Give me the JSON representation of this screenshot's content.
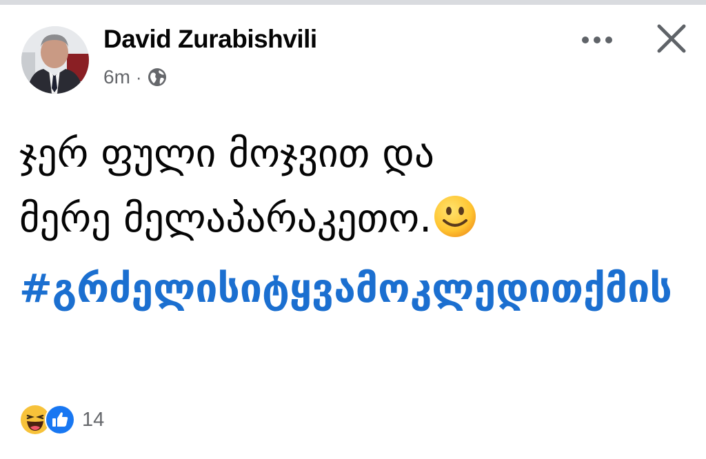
{
  "post": {
    "author_name": "David Zurabishvili",
    "timestamp": "6m",
    "separator": "·",
    "privacy_icon": "globe-icon",
    "text_lines": [
      "ჯერ ფული მოჯვით და",
      "მერე მელაპარაკეთო."
    ],
    "emoji": "slightly-smiling-face",
    "hashtag": "#გრძელისიტყვამოკლედითქმის"
  },
  "header_actions": {
    "more_icon": "more-options-icon",
    "close_icon": "close-icon"
  },
  "reactions": {
    "icons": [
      "haha-reaction-icon",
      "like-reaction-icon"
    ],
    "count": "14"
  },
  "colors": {
    "hashtag": "#1b6fd0",
    "text": "#050505",
    "secondary": "#65676b",
    "like_blue": "#1877f2"
  }
}
